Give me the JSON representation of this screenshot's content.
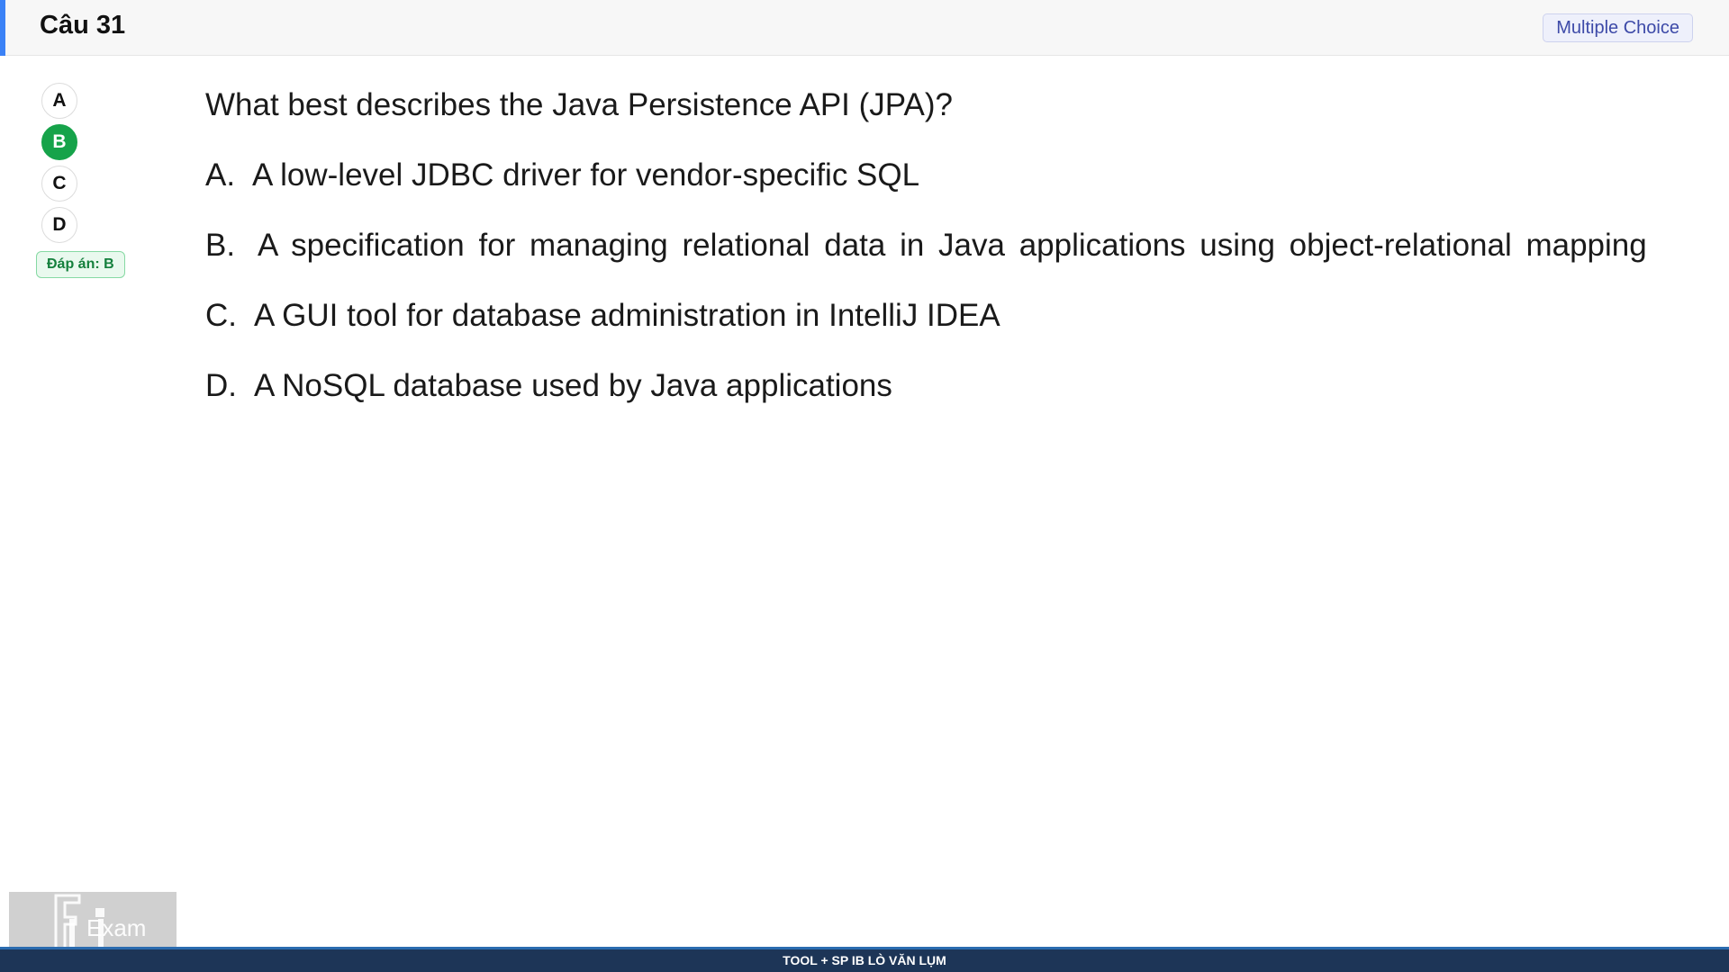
{
  "header": {
    "title": "Câu 31",
    "type_badge": "Multiple Choice"
  },
  "options_nav": {
    "items": [
      {
        "letter": "A",
        "selected": false
      },
      {
        "letter": "B",
        "selected": true
      },
      {
        "letter": "C",
        "selected": false
      },
      {
        "letter": "D",
        "selected": false
      }
    ],
    "answer_badge": "Đáp án: B"
  },
  "question": {
    "text": "What best describes the Java Persistence API (JPA)?",
    "choices": [
      {
        "letter": "A.",
        "text": "A low-level JDBC driver for vendor-specific SQL"
      },
      {
        "letter": "B.",
        "text": "A specification for managing relational data in Java applications using object-relational mapping"
      },
      {
        "letter": "C.",
        "text": "A GUI tool for database administration in IntelliJ IDEA"
      },
      {
        "letter": "D.",
        "text": "A NoSQL database used by Java applications"
      }
    ]
  },
  "logo": {
    "icon": "fu-exam-logo",
    "text": "Exam"
  },
  "footer": {
    "text": "TOOL + SP IB LÒ VĂN LỤM"
  },
  "colors": {
    "accent": "#3b82f6",
    "selected": "#16a34a",
    "footer_bg": "#1d3557"
  }
}
